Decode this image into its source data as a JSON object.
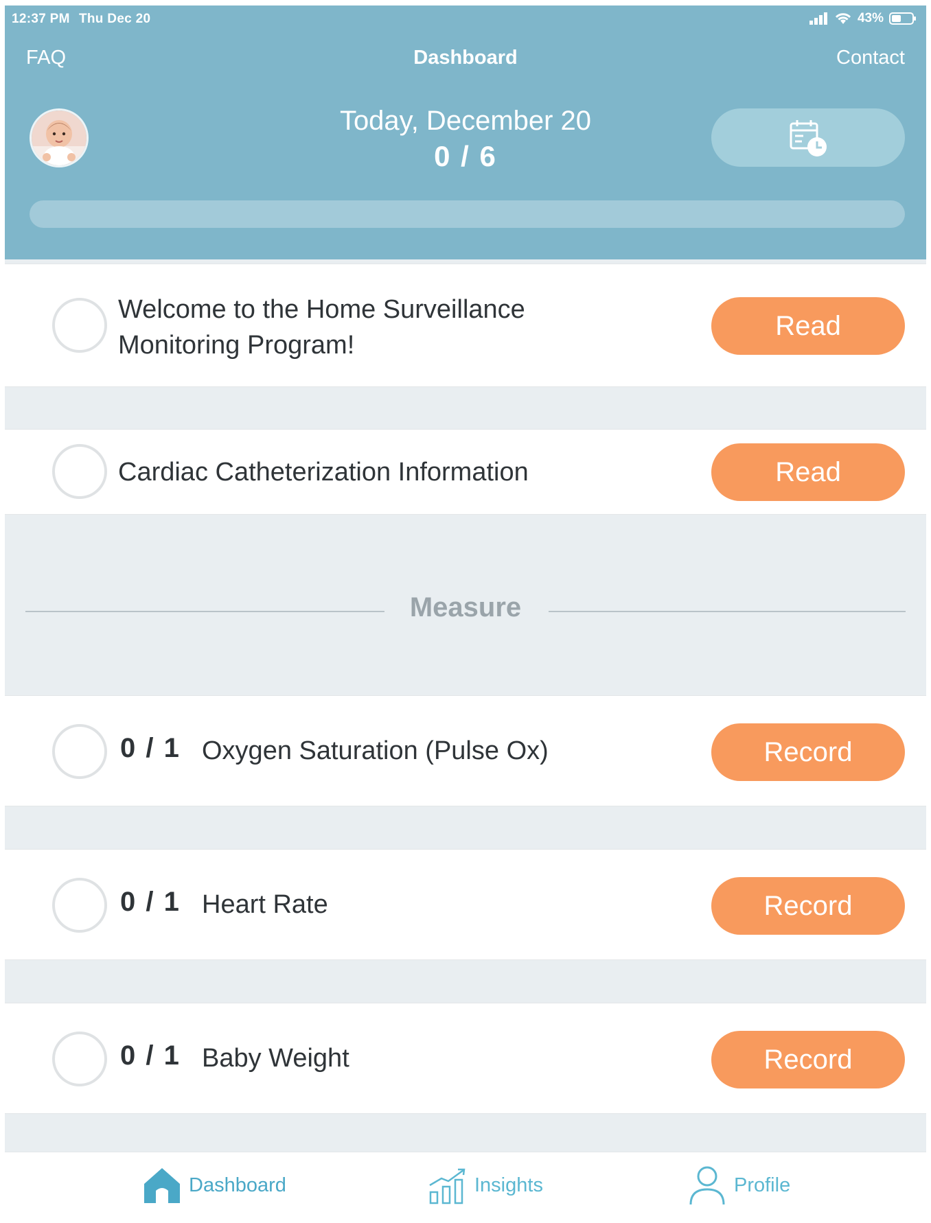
{
  "status_bar": {
    "time": "12:37 PM",
    "date": "Thu Dec 20",
    "battery": "43%"
  },
  "nav": {
    "left": "FAQ",
    "title": "Dashboard",
    "right": "Contact"
  },
  "summary": {
    "date_label": "Today, December 20",
    "progress_text": "0 / 6",
    "progress_fraction": 0
  },
  "read_items": [
    {
      "title_line1": "Welcome to the Home Surveillance",
      "title_line2": "Monitoring Program!",
      "button": "Read"
    },
    {
      "title": "Cardiac Catheterization Information",
      "button": "Read"
    }
  ],
  "measure_section": {
    "label": "Measure",
    "items": [
      {
        "progress": "0 / 1",
        "title": "Oxygen Saturation (Pulse Ox)",
        "button": "Record"
      },
      {
        "progress": "0 / 1",
        "title": "Heart Rate",
        "button": "Record"
      },
      {
        "progress": "0 / 1",
        "title": "Baby Weight",
        "button": "Record"
      }
    ]
  },
  "tabs": [
    {
      "label": "Dashboard",
      "icon": "home-icon"
    },
    {
      "label": "Insights",
      "icon": "chart-icon"
    },
    {
      "label": "Profile",
      "icon": "person-icon"
    }
  ],
  "colors": {
    "header": "#7fb6ca",
    "accent_button": "#f89a5d",
    "tab_accent": "#4aa8c7"
  }
}
